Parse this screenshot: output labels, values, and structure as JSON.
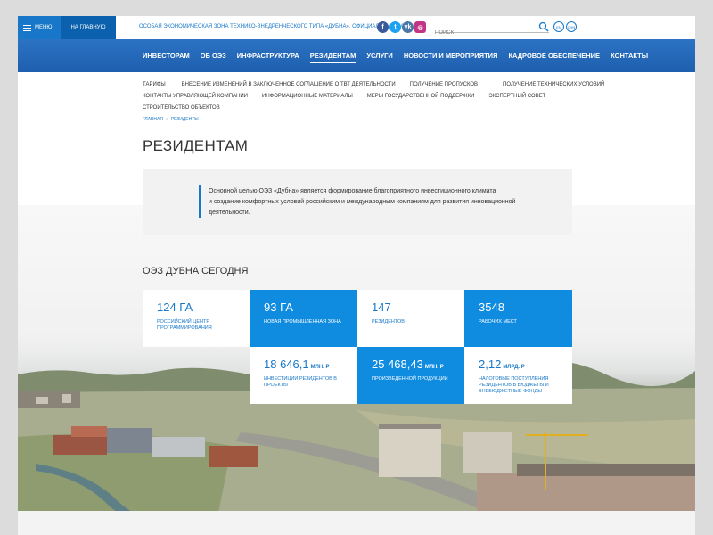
{
  "header": {
    "menu_label": "МЕНЮ",
    "home_label": "НА ГЛАВНУЮ",
    "site_title": "ОСОБАЯ ЭКОНОМИЧЕСКАЯ ЗОНА ТЕХНИКО-ВНЕДРЕНЧЕСКОГО ТИПА «ДУБНА». ОФИЦИАЛЬНЫЙ САЙТ",
    "search_placeholder": "ПОИСК",
    "languages": [
      "EN",
      "CHN"
    ],
    "socials": [
      {
        "icon": "facebook-icon",
        "glyph": "f"
      },
      {
        "icon": "twitter-icon",
        "glyph": "t"
      },
      {
        "icon": "vk-icon",
        "glyph": "vk"
      },
      {
        "icon": "instagram-icon",
        "glyph": "◎"
      }
    ]
  },
  "main_nav": {
    "items": [
      "ИНВЕСТОРАМ",
      "ОБ ОЭЗ",
      "ИНФРАСТРУКТУРА",
      "РЕЗИДЕНТАМ",
      "УСЛУГИ",
      "НОВОСТИ И МЕРОПРИЯТИЯ",
      "КАДРОВОЕ ОБЕСПЕЧЕНИЕ",
      "КОНТАКТЫ"
    ],
    "active": "РЕЗИДЕНТАМ"
  },
  "sub_nav": {
    "row1": [
      "ТАРИФЫ",
      "ВНЕСЕНИЕ ИЗМЕНЕНИЙ В ЗАКЛЮЧЕННОЕ СОГЛАШЕНИЕ О ТВТ ДЕЯТЕЛЬНОСТИ",
      "ПОЛУЧЕНИЕ ПРОПУСКОВ",
      "ПОЛУЧЕНИЕ ТЕХНИЧЕСКИХ УСЛОВИЙ"
    ],
    "row2": [
      "КОНТАКТЫ УПРАВЛЯЮЩЕЙ КОМПАНИИ",
      "ИНФОРМАЦИОННЫЕ МАТЕРИАЛЫ",
      "МЕРЫ ГОСУДАРСТВЕННОЙ ПОДДЕРЖКИ",
      "ЭКСПЕРТНЫЙ СОВЕТ"
    ],
    "row3": [
      "СТРОИТЕЛЬСТВО ОБЪЕКТОВ"
    ]
  },
  "breadcrumb": {
    "home": "ГЛАВНАЯ",
    "separator": "»",
    "current": "РЕЗИДЕНТЫ"
  },
  "page_title": "РЕЗИДЕНТАМ",
  "intro": {
    "lines": [
      "Основной целью ОЭЗ «Дубна» является формирование благоприятного инвестиционного климата",
      "и создание комфортных условий российским и международным компаниям для развития инновационной",
      "деятельности."
    ]
  },
  "stats_section": {
    "title": "ОЭЗ ДУБНА СЕГОДНЯ",
    "cells": [
      {
        "value": "124 ГА",
        "unit": "",
        "label": "РОССИЙСКИЙ ЦЕНТР ПРОГРАММИРОВАНИЯ"
      },
      {
        "value": "93 ГА",
        "unit": "",
        "label": "НОВАЯ ПРОМЫШЛЕННАЯ ЗОНА"
      },
      {
        "value": "147",
        "unit": "",
        "label": "РЕЗИДЕНТОВ"
      },
      {
        "value": "3548",
        "unit": "",
        "label": "РАБОЧИХ МЕСТ"
      },
      {
        "value": "18 646,1",
        "unit": "МЛН. Р",
        "label": "ИНВЕСТИЦИИ РЕЗИДЕНТОВ В ПРОЕКТЫ"
      },
      {
        "value": "25 468,43",
        "unit": "МЛН. Р",
        "label": "ПРОИЗВЕДЕННОЙ ПРОДУКЦИИ"
      },
      {
        "value": "2,12",
        "unit": "МЛРД. Р",
        "label": "НАЛОГОВЫЕ ПОСТУПЛЕНИЯ РЕЗИДЕНТОВ В БЮДЖЕТЫ И ВНЕБЮДЖЕТНЫЕ ФОНДЫ"
      }
    ]
  },
  "colors": {
    "brand_blue": "#1877c8",
    "nav_blue": "#2c73c4",
    "tile_blue": "#0f8be0"
  }
}
